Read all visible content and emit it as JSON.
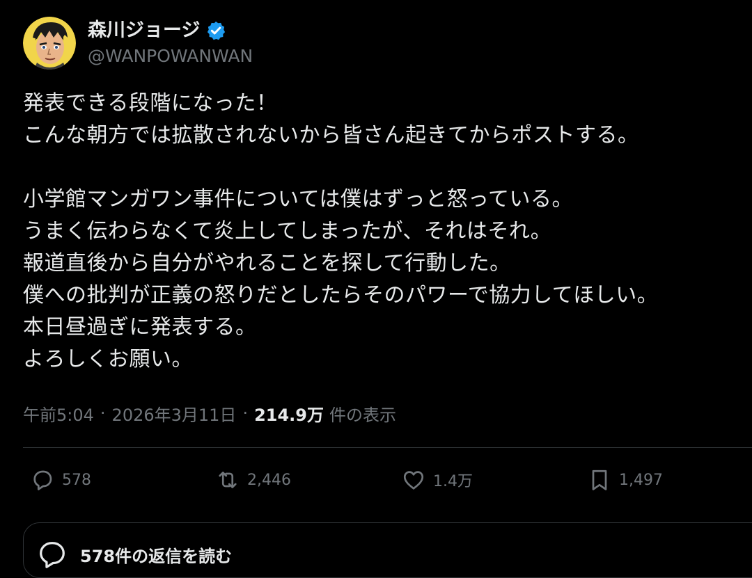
{
  "author": {
    "display_name": "森川ジョージ",
    "handle": "@WANPOWANWAN",
    "verified": true,
    "avatar": "manga-character-avatar"
  },
  "post": {
    "lines": [
      "発表できる段階になった！",
      "こんな朝方では拡散されないから皆さん起きてからポストする。",
      "",
      "小学館マンガワン事件については僕はずっと怒っている。",
      "うまく伝わらなくて炎上してしまったが、それはそれ。",
      "報道直後から自分がやれることを探して行動した。",
      "僕への批判が正義の怒りだとしたらそのパワーで協力してほしい。",
      "本日昼過ぎに発表する。",
      "よろしくお願い。"
    ]
  },
  "meta": {
    "time": "午前5:04",
    "separator": "·",
    "date": "2026年3月11日",
    "views_count": "214.9万",
    "views_label": "件の表示"
  },
  "actions": {
    "reply": {
      "icon": "reply-icon",
      "count": "578"
    },
    "repost": {
      "icon": "repost-icon",
      "count": "2,446"
    },
    "like": {
      "icon": "heart-icon",
      "count": "1.4万"
    },
    "bookmark": {
      "icon": "bookmark-icon",
      "count": "1,497"
    }
  },
  "replies": {
    "icon": "reply-icon",
    "label": "578件の返信を読む"
  },
  "colors": {
    "background": "#000000",
    "text_primary": "#e7e9ea",
    "text_secondary": "#71767b",
    "divider": "#2f3336",
    "verified_badge": "#1d9bf0"
  }
}
